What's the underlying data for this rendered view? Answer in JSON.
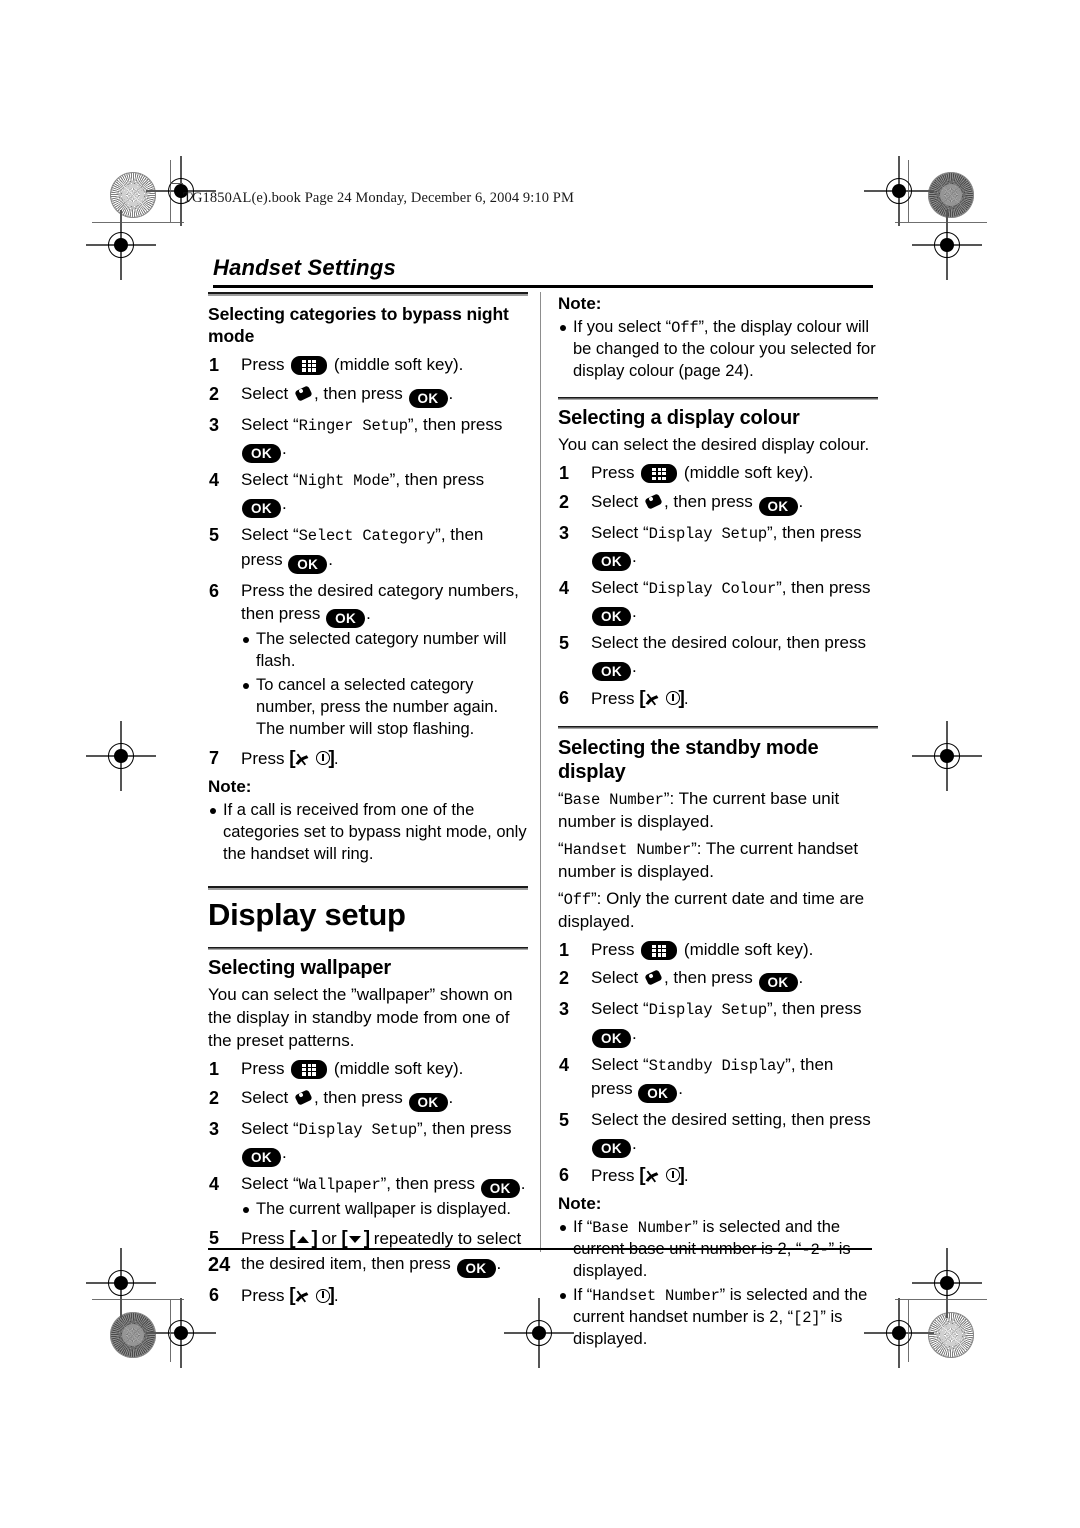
{
  "page": {
    "file_header": "TG1850AL(e).book  Page 24  Monday, December 6, 2004  9:10 PM",
    "running_head": "Handset Settings",
    "page_number": "24"
  },
  "icons": {
    "soft_key": "middle-soft-key-icon",
    "ok_key": "OK",
    "handset_menu": "handset-settings-icon",
    "off_key": "off-power-key-icon",
    "up_key": "up-arrow-key-icon",
    "down_key": "down-arrow-key-icon"
  },
  "left_column": {
    "section1": {
      "heading": "Selecting categories to bypass night mode",
      "steps": [
        {
          "num": "1",
          "before": "Press ",
          "key": "soft",
          "after": " (middle soft key)."
        },
        {
          "num": "2",
          "before": "Select ",
          "key": "handset",
          "mid": ", then press ",
          "key2": "ok",
          "after": "."
        },
        {
          "num": "3",
          "before": "Select “",
          "mono": "Ringer Setup",
          "mid": "”, then press ",
          "key2": "ok",
          "after": "."
        },
        {
          "num": "4",
          "before": "Select “",
          "mono": "Night Mode",
          "mid": "”, then press ",
          "key2": "ok",
          "after": "."
        },
        {
          "num": "5",
          "before": "Select “",
          "mono": "Select Category",
          "mid": "”, then press ",
          "key2": "ok",
          "after": "."
        },
        {
          "num": "6",
          "before": "Press the desired category numbers, then press ",
          "key2": "ok",
          "after": ".",
          "bullets": [
            "The selected category number will flash.",
            "To cancel a selected category number, press the number again. The number will stop flashing."
          ]
        },
        {
          "num": "7",
          "before": "Press ",
          "key": "off",
          "after": "."
        }
      ],
      "note_label": "Note:",
      "notes": [
        "If a call is received from one of the categories set to bypass night mode, only the handset will ring."
      ]
    },
    "section2": {
      "title": "Display setup",
      "heading": "Selecting wallpaper",
      "intro": "You can select the ”wallpaper” shown on the display in standby mode from one of the preset patterns.",
      "steps": [
        {
          "num": "1",
          "before": "Press ",
          "key": "soft",
          "after": " (middle soft key)."
        },
        {
          "num": "2",
          "before": "Select ",
          "key": "handset",
          "mid": ", then press ",
          "key2": "ok",
          "after": "."
        },
        {
          "num": "3",
          "before": "Select “",
          "mono": "Display Setup",
          "mid": "”, then press ",
          "key2": "ok",
          "after": "."
        },
        {
          "num": "4",
          "before": "Select “",
          "mono": "Wallpaper",
          "mid": "”, then press ",
          "key2": "ok",
          "after": ".",
          "bullets": [
            "The current wallpaper is displayed."
          ]
        },
        {
          "num": "5",
          "before": "Press ",
          "key": "up",
          "mid": " or ",
          "key2b": "down",
          "mid2": " repeatedly to select the desired item, then press ",
          "key2": "ok",
          "after": "."
        },
        {
          "num": "6",
          "before": "Press ",
          "key": "off",
          "after": "."
        }
      ]
    }
  },
  "right_column": {
    "note_top": {
      "label": "Note:",
      "items": [
        {
          "a": "If you select “",
          "mono": "Off",
          "b": "”, the display colour will be changed to the colour you selected for display colour (page 24)."
        }
      ]
    },
    "section_colour": {
      "heading": "Selecting a display colour",
      "intro": "You can select the desired display colour.",
      "steps": [
        {
          "num": "1",
          "before": "Press ",
          "key": "soft",
          "after": " (middle soft key)."
        },
        {
          "num": "2",
          "before": "Select ",
          "key": "handset",
          "mid": ", then press ",
          "key2": "ok",
          "after": "."
        },
        {
          "num": "3",
          "before": "Select “",
          "mono": "Display Setup",
          "mid": "”, then press ",
          "key2": "ok",
          "after": "."
        },
        {
          "num": "4",
          "before": "Select “",
          "mono": "Display Colour",
          "mid": "”, then press ",
          "key2": "ok",
          "after": "."
        },
        {
          "num": "5",
          "before": "Select the desired colour, then press ",
          "key2": "ok",
          "after": "."
        },
        {
          "num": "6",
          "before": "Press ",
          "key": "off",
          "after": "."
        }
      ]
    },
    "section_standby": {
      "heading": "Selecting the standby mode display",
      "definitions": [
        {
          "mono": "Base Number",
          "text": ": The current base unit number is displayed."
        },
        {
          "mono": "Handset Number",
          "text": ": The current handset number is displayed."
        },
        {
          "mono": "Off",
          "text": ": Only the current date and time are displayed."
        }
      ],
      "steps": [
        {
          "num": "1",
          "before": "Press ",
          "key": "soft",
          "after": " (middle soft key)."
        },
        {
          "num": "2",
          "before": "Select ",
          "key": "handset",
          "mid": ", then press ",
          "key2": "ok",
          "after": "."
        },
        {
          "num": "3",
          "before": "Select “",
          "mono": "Display Setup",
          "mid": "”, then press ",
          "key2": "ok",
          "after": "."
        },
        {
          "num": "4",
          "before": "Select “",
          "mono": "Standby Display",
          "mid": "”, then press ",
          "key2": "ok",
          "after": "."
        },
        {
          "num": "5",
          "before": "Select the desired setting, then press ",
          "key2": "ok",
          "after": "."
        },
        {
          "num": "6",
          "before": "Press ",
          "key": "off",
          "after": "."
        }
      ],
      "note_label": "Note:",
      "notes": [
        {
          "a": "If “",
          "mono": "Base Number",
          "b": "” is selected and the current base unit number is 2, “",
          "mono2": "-2-",
          "c": "” is displayed."
        },
        {
          "a": "If “",
          "mono": "Handset Number",
          "b": "” is selected and the current handset number is 2, “",
          "mono2": "[2]",
          "c": "” is displayed."
        }
      ]
    }
  }
}
